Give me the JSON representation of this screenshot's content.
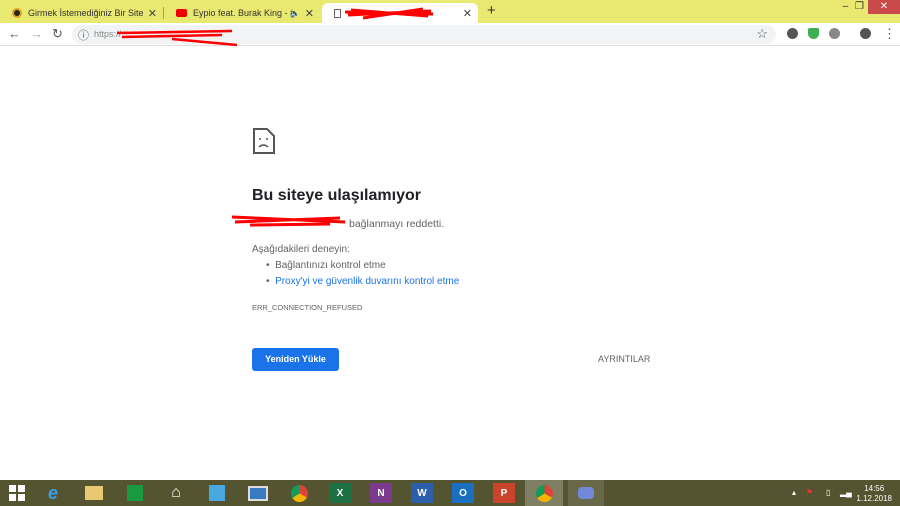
{
  "tabs": [
    {
      "title": "Girmek İstemediğiniz Bir Siteyi Engelleme",
      "close": "✕"
    },
    {
      "title": "Eypio feat. Burak King - #Sen",
      "close": "✕",
      "audio": "🔈"
    },
    {
      "title": "",
      "close": "✕"
    }
  ],
  "new_tab": "+",
  "window": {
    "minimize": "–",
    "restore": "❐",
    "close": "✕"
  },
  "toolbar": {
    "back": "←",
    "forward": "→",
    "reload": "↻",
    "url": "https://",
    "star": "☆",
    "menu": "⋮"
  },
  "error": {
    "title": "Bu siteye ulaşılamıyor",
    "message": "bağlanmayı reddetti.",
    "try_label": "Aşağıdakileri deneyin:",
    "suggestions": [
      "Bağlantınızı kontrol etme",
      "Proxy'yi ve güvenlik duvarını kontrol etme"
    ],
    "code": "ERR_CONNECTION_REFUSED",
    "reload_button": "Yeniden Yükle",
    "details_button": "AYRINTILAR"
  },
  "taskbar": {
    "apps": [
      "E",
      "X",
      "N",
      "W",
      "O",
      "P"
    ],
    "time": "14:56",
    "date": "1.12.2018"
  },
  "colors": {
    "tabbar": "#e9e870",
    "accent": "#1a73e8",
    "taskbar": "#555430",
    "close": "#c94a4a"
  }
}
